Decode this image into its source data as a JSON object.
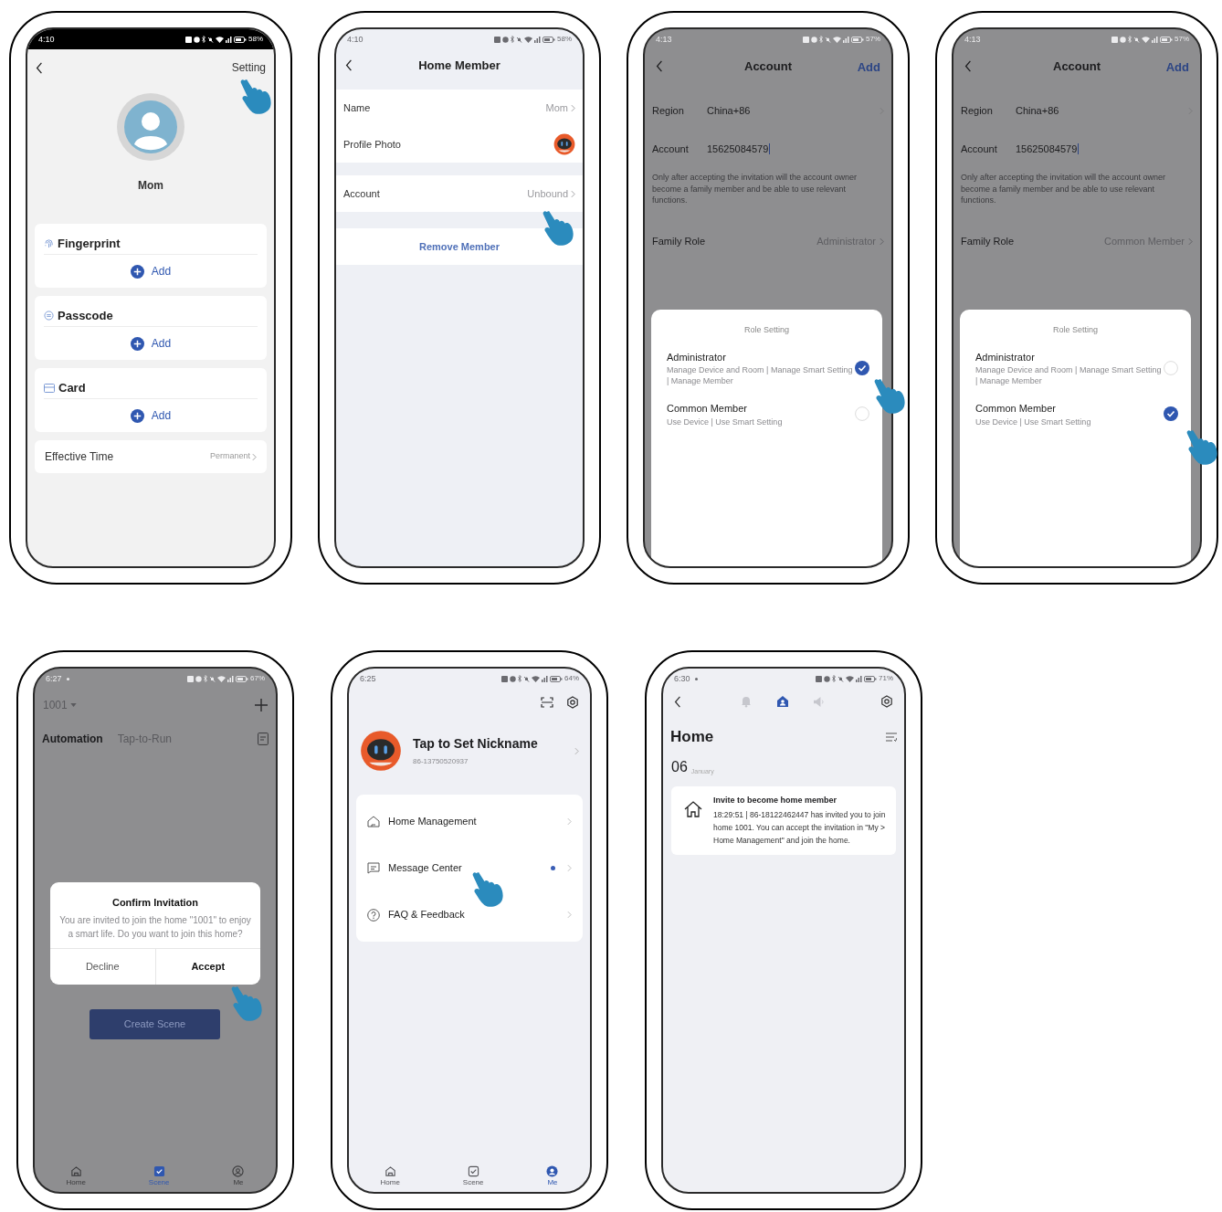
{
  "phones": [
    {
      "kind": "member_detail",
      "status": {
        "time": "4:10",
        "battery": "58%",
        "dot": false
      },
      "action": "Setting",
      "member_name": "Mom",
      "credentials": [
        {
          "kind": "fingerprint",
          "title": "Fingerprint",
          "add": "Add"
        },
        {
          "kind": "passcode",
          "title": "Passcode",
          "add": "Add"
        },
        {
          "kind": "card",
          "title": "Card",
          "add": "Add"
        }
      ],
      "effective_time": {
        "label": "Effective Time",
        "value": "Permanent"
      }
    },
    {
      "kind": "home_member",
      "status": {
        "time": "4:10",
        "battery": "58%",
        "dot": false
      },
      "title": "Home Member",
      "groups": [
        [
          {
            "kind": "text",
            "label": "Name",
            "value": "Mom"
          },
          {
            "kind": "photo",
            "label": "Profile Photo"
          }
        ],
        [
          {
            "kind": "text",
            "label": "Account",
            "value": "Unbound"
          }
        ]
      ],
      "remove": "Remove Member"
    },
    {
      "kind": "account",
      "status": {
        "time": "4:13",
        "battery": "57%",
        "dot": false
      },
      "title": "Account",
      "action": "Add",
      "region": {
        "label": "Region",
        "value": "China+86"
      },
      "account": {
        "label": "Account",
        "value": "15625084579"
      },
      "note": "Only after accepting the invitation will the account owner become a family member and be able to use relevant functions.",
      "family_role": {
        "label": "Family Role",
        "value": "Administrator"
      },
      "sheet": {
        "title": "Role Setting",
        "options": [
          {
            "title": "Administrator",
            "description": "Manage Device and Room | Manage Smart Setting | Manage Member",
            "selected": true
          },
          {
            "title": "Common Member",
            "description": "Use Device | Use Smart Setting",
            "selected": false
          }
        ]
      }
    },
    {
      "kind": "account",
      "status": {
        "time": "4:13",
        "battery": "57%",
        "dot": false
      },
      "title": "Account",
      "action": "Add",
      "region": {
        "label": "Region",
        "value": "China+86"
      },
      "account": {
        "label": "Account",
        "value": "15625084579"
      },
      "note": "Only after accepting the invitation will the account owner become a family member and be able to use relevant functions.",
      "family_role": {
        "label": "Family Role",
        "value": "Common Member"
      },
      "sheet": {
        "title": "Role Setting",
        "options": [
          {
            "title": "Administrator",
            "description": "Manage Device and Room | Manage Smart Setting | Manage Member",
            "selected": false
          },
          {
            "title": "Common Member",
            "description": "Use Device | Use Smart Setting",
            "selected": true
          }
        ]
      }
    },
    {
      "kind": "scene",
      "status": {
        "time": "6:27",
        "battery": "67%",
        "dot": true
      },
      "home": "1001",
      "tabs": [
        {
          "label": "Automation",
          "selected": true
        },
        {
          "label": "Tap-to-Run",
          "selected": false
        }
      ],
      "dialog": {
        "title": "Confirm Invitation",
        "message": "You are invited to join the home \"1001\" to enjoy a smart life. Do you want to join this home?",
        "buttons": [
          {
            "label": "Decline",
            "kind": "secondary"
          },
          {
            "label": "Accept",
            "kind": "primary"
          }
        ]
      },
      "create_button": "Create Scene",
      "nav": [
        {
          "kind": "home",
          "label": "Home",
          "selected": false
        },
        {
          "kind": "scene",
          "label": "Scene",
          "selected": true
        },
        {
          "kind": "me",
          "label": "Me",
          "selected": false
        }
      ]
    },
    {
      "kind": "me",
      "status": {
        "time": "6:25",
        "battery": "64%",
        "dot": false
      },
      "nickname": "Tap to Set Nickname",
      "phone": "86-13750520937",
      "menu": [
        {
          "kind": "home",
          "label": "Home Management",
          "unread": false
        },
        {
          "kind": "message",
          "label": "Message Center",
          "unread": true
        },
        {
          "kind": "faq",
          "label": "FAQ & Feedback",
          "unread": false
        }
      ],
      "nav": [
        {
          "kind": "home",
          "label": "Home",
          "selected": false
        },
        {
          "kind": "scene",
          "label": "Scene",
          "selected": false
        },
        {
          "kind": "me",
          "label": "Me",
          "selected": true
        }
      ]
    },
    {
      "kind": "messages",
      "status": {
        "time": "6:30",
        "battery": "71%",
        "dot": true
      },
      "tabs": [
        {
          "kind": "alert",
          "selected": false
        },
        {
          "kind": "home",
          "selected": true
        },
        {
          "kind": "notice",
          "selected": false
        }
      ],
      "title": "Home",
      "date": {
        "day": "06",
        "month": "January"
      },
      "message": {
        "title": "Invite to become home member",
        "body": "18:29:51 | 86-18122462447 has invited you to join home 1001. You can accept the invitation in \"My > Home Management\" and join the home."
      }
    }
  ]
}
